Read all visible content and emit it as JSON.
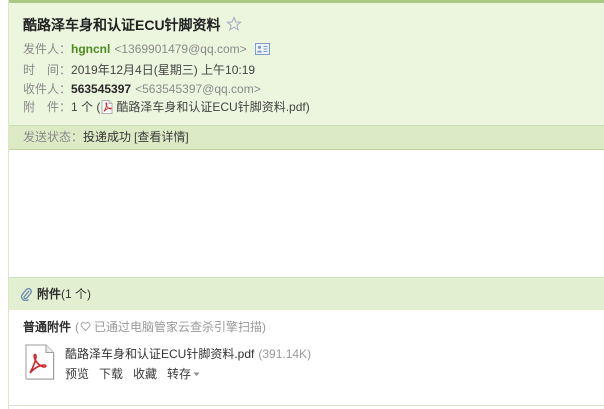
{
  "theme": {
    "accent_green": "#4d8c1c",
    "header_bg": "#ecf5de",
    "status_bg": "#dcebc6",
    "attach_header_bg": "#e3efd1"
  },
  "icons": {
    "star": "star-outline-icon",
    "contact": "contact-card-icon",
    "attachment_inline": "pdf-file-icon",
    "paperclip": "paperclip-icon",
    "scan": "security-heart-icon",
    "file_large": "pdf-file-icon",
    "more": "chevron-down-icon"
  },
  "mail": {
    "subject": "酷路泽车身和认证ECU针脚资料",
    "from": {
      "label": "发件人：",
      "name": "hgncnl",
      "address": "<1369901479@qq.com>"
    },
    "time": {
      "label": "时　间：",
      "value": "2019年12月4日(星期三) 上午10:19"
    },
    "to": {
      "label": "收件人：",
      "name": "563545397",
      "address": "<563545397@qq.com>"
    },
    "attachment": {
      "label": "附　件：",
      "count_text": "1 个 (",
      "name": "酷路泽车身和认证ECU针脚资料.pdf",
      "close": ")"
    },
    "status": {
      "label": "发送状态：",
      "value": "投递成功",
      "detail_link": "[查看详情]"
    }
  },
  "attachments": {
    "header_title": "附件",
    "header_count": "(1 个)",
    "group_label": "普通附件",
    "scan_prefix": "(",
    "scan_text": "已通过电脑管家云查杀引擎扫描)",
    "files": [
      {
        "name": "酷路泽车身和认证ECU针脚资料.pdf",
        "size": "(391.14K)",
        "actions": [
          "预览",
          "下载",
          "收藏",
          "转存"
        ]
      }
    ]
  }
}
